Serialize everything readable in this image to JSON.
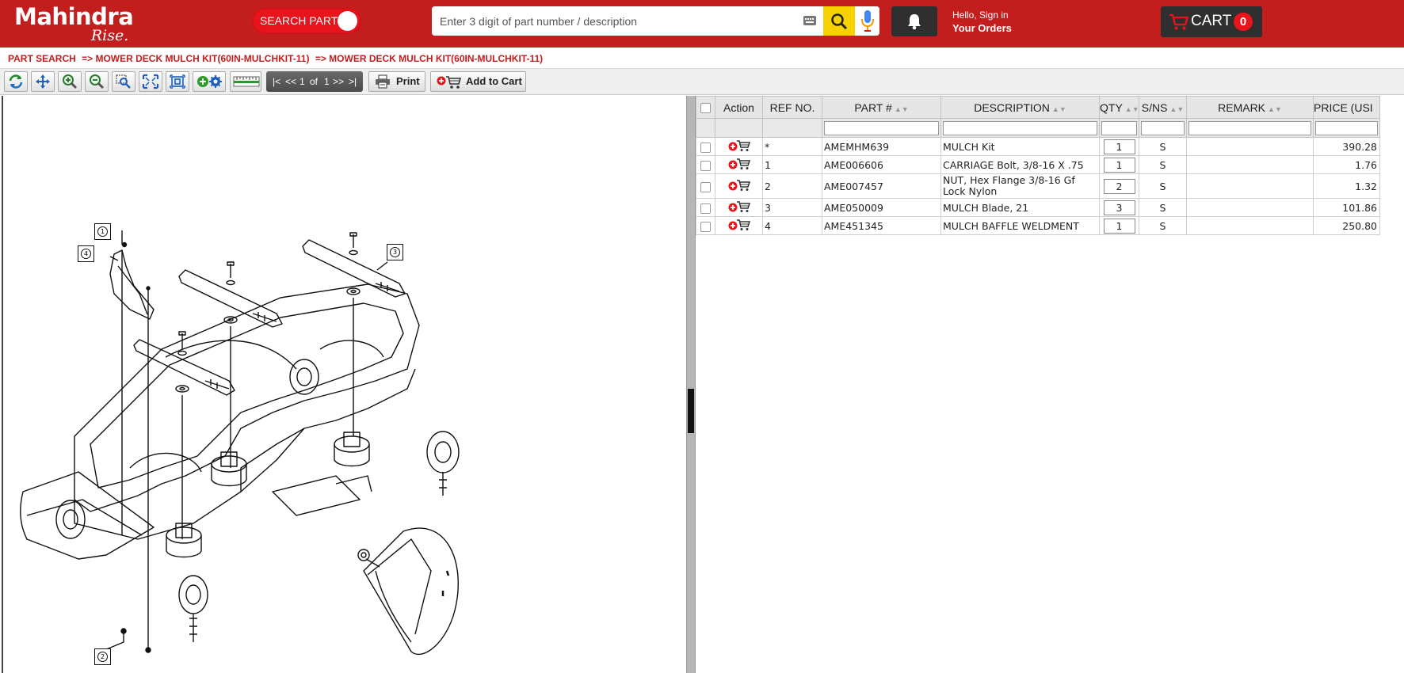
{
  "header": {
    "logo_main": "Mahindra",
    "logo_sub": "Rise.",
    "search_part_label": "SEARCH PART",
    "search_placeholder": "Enter 3 digit of part number / description",
    "account_hello": "Hello, Sign in",
    "account_orders": "Your Orders",
    "cart_label": "CART",
    "cart_count": "0"
  },
  "breadcrumb": {
    "items": [
      "PART SEARCH",
      "=> MOWER DECK MULCH KIT(60IN-MULCHKIT-11)",
      "=> MOWER DECK MULCH KIT(60IN-MULCHKIT-11)"
    ]
  },
  "toolbar": {
    "pager": {
      "first": "|<",
      "prev": "<<",
      "page": "1",
      "of": "of",
      "total": "1",
      "next": ">>",
      "last": ">|"
    },
    "print_label": "Print",
    "add_to_cart_label": "Add to Cart"
  },
  "diagram": {
    "callouts": [
      "1",
      "2",
      "3",
      "4"
    ]
  },
  "table": {
    "columns": [
      "Action",
      "REF NO.",
      "PART #",
      "DESCRIPTION",
      "QTY",
      "S/NS",
      "REMARK",
      "PRICE (USI"
    ],
    "rows": [
      {
        "ref": "*",
        "part": "AMEMHM639",
        "description": "MULCH Kit",
        "qty": "1",
        "sns": "S",
        "remark": "",
        "price": "390.28"
      },
      {
        "ref": "1",
        "part": "AME006606",
        "description": "CARRIAGE Bolt, 3/8-16 X .75",
        "qty": "1",
        "sns": "S",
        "remark": "",
        "price": "1.76"
      },
      {
        "ref": "2",
        "part": "AME007457",
        "description": "NUT, Hex Flange 3/8-16 Gf Lock Nylon",
        "qty": "2",
        "sns": "S",
        "remark": "",
        "price": "1.32"
      },
      {
        "ref": "3",
        "part": "AME050009",
        "description": "MULCH Blade, 21",
        "qty": "3",
        "sns": "S",
        "remark": "",
        "price": "101.86"
      },
      {
        "ref": "4",
        "part": "AME451345",
        "description": "MULCH BAFFLE WELDMENT",
        "qty": "1",
        "sns": "S",
        "remark": "",
        "price": "250.80"
      }
    ]
  },
  "colors": {
    "header_red": "#c31e1e",
    "search_yellow": "#f7d100",
    "badge_red": "#e8141b",
    "dark_button": "#2f2f2f"
  }
}
